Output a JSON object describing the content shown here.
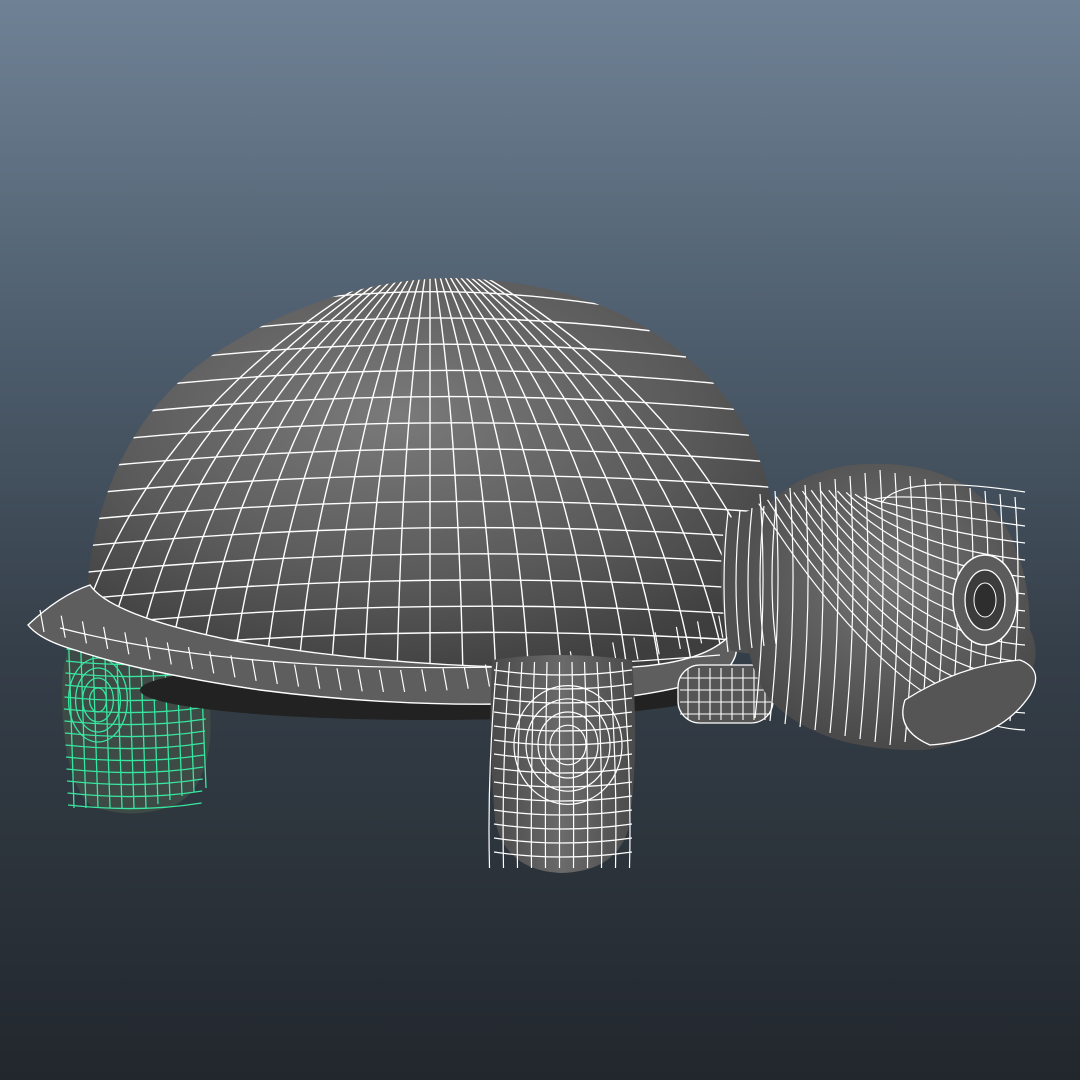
{
  "viewport": {
    "object": "turtle-model",
    "display_mode": "wireframe-on-shaded",
    "selected_component": "rear-leg",
    "colors": {
      "background_top": "#6f8295",
      "background_bottom": "#22272d",
      "mesh_fill": "#5a5a5a",
      "wireframe": "#ffffff",
      "selection_wireframe": "#37e6a0"
    }
  }
}
